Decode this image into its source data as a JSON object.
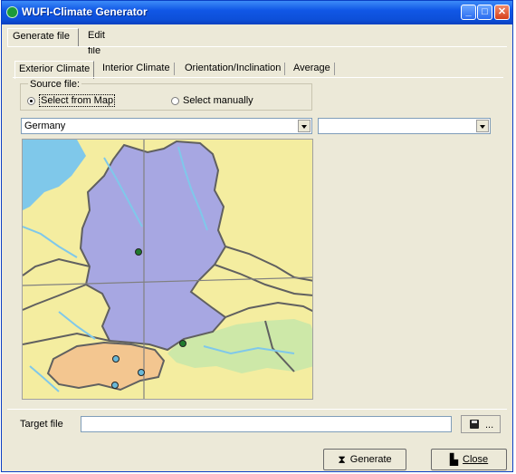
{
  "window": {
    "title": "WUFI-Climate Generator"
  },
  "top_tabs": [
    {
      "label": "Generate file"
    },
    {
      "label": "Edit file"
    }
  ],
  "sub_tabs": [
    {
      "label": "Exterior Climate"
    },
    {
      "label": "Interior Climate"
    },
    {
      "label": "Orientation/Inclination"
    },
    {
      "label": "Average"
    }
  ],
  "source": {
    "legend": "Source file:",
    "option_map": "Select from Map",
    "option_manual": "Select manually",
    "selected": "Select from Map"
  },
  "country_select": {
    "value": "Germany"
  },
  "location_select": {
    "value": ""
  },
  "map": {
    "stations_germany_color": "#1f7a2e",
    "stations_swiss_color": "#69b8d8",
    "germany_color": "#a7a7e2",
    "switzerland_color": "#f3c690",
    "austria_color": "#cde8a8",
    "neighbor_color": "#f4eda0",
    "water_color": "#7fc8ea"
  },
  "target": {
    "label": "Target file",
    "value": "",
    "browse_label": "..."
  },
  "buttons": {
    "generate": "Generate",
    "close": "Close"
  },
  "icons": {
    "app": "globe-icon",
    "save": "disk-icon",
    "generate": "hourglass-icon",
    "close": "door-icon"
  }
}
